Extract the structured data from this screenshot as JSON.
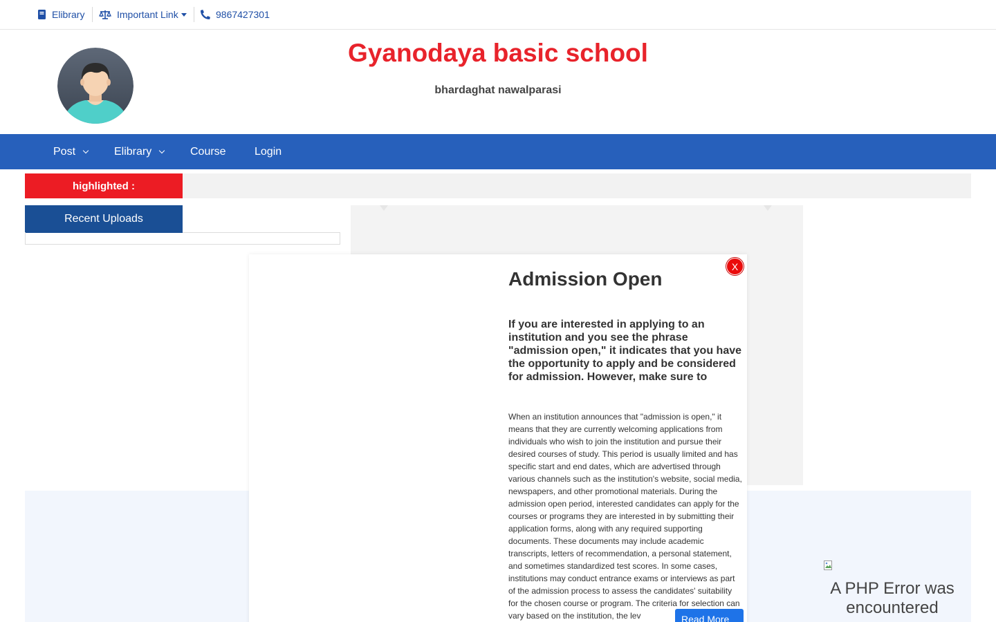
{
  "topbar": {
    "elibrary_label": "Elibrary",
    "important_link_label": "Important Link",
    "phone": "9867427301"
  },
  "header": {
    "title": "Gyanodaya basic school",
    "subtitle": "bhardaghat nawalparasi"
  },
  "nav": {
    "items": [
      {
        "label": "Post"
      },
      {
        "label": "Elibrary"
      },
      {
        "label": "Course"
      },
      {
        "label": "Login"
      }
    ]
  },
  "highlight": {
    "label": "highlighted :"
  },
  "recent": {
    "heading": "Recent Uploads"
  },
  "modal": {
    "close_label": "X",
    "title": "Admission Open",
    "lead": "If you are interested in applying to an institution and you see the phrase \"admission open,\" it indicates that you have the opportunity to apply and be considered for admission. However, make sure to",
    "body": "When an institution announces that \"admission is open,\" it means that they are currently welcoming applications from individuals who wish to join the institution and pursue their desired courses of study. This period is usually limited and has specific start and end dates, which are advertised through various channels such as the institution's website, social media, newspapers, and other promotional materials. During the admission open period, interested candidates can apply for the courses or programs they are interested in by submitting their application forms, along with any required supporting documents. These documents may include academic transcripts, letters of recommendation, a personal statement, and sometimes standardized test scores. In some cases, institutions may conduct entrance exams or interviews as part of the admission process to assess the candidates' suitability for the chosen course or program. The criteria for selection can vary based on the institution, the lev",
    "read_more": "Read More"
  },
  "error_panel": {
    "message": "A PHP Error was encountered"
  },
  "colors": {
    "brand_red": "#e8232b",
    "nav_blue": "#2760bb",
    "recent_blue": "#1a4f95",
    "link_blue": "#1f4fa6",
    "button_blue": "#1e73e8"
  },
  "icons": {
    "elibrary": "book-icon",
    "important_link": "scale-icon",
    "phone": "phone-icon",
    "avatar": "user-avatar",
    "broken_image": "broken-image-icon"
  }
}
